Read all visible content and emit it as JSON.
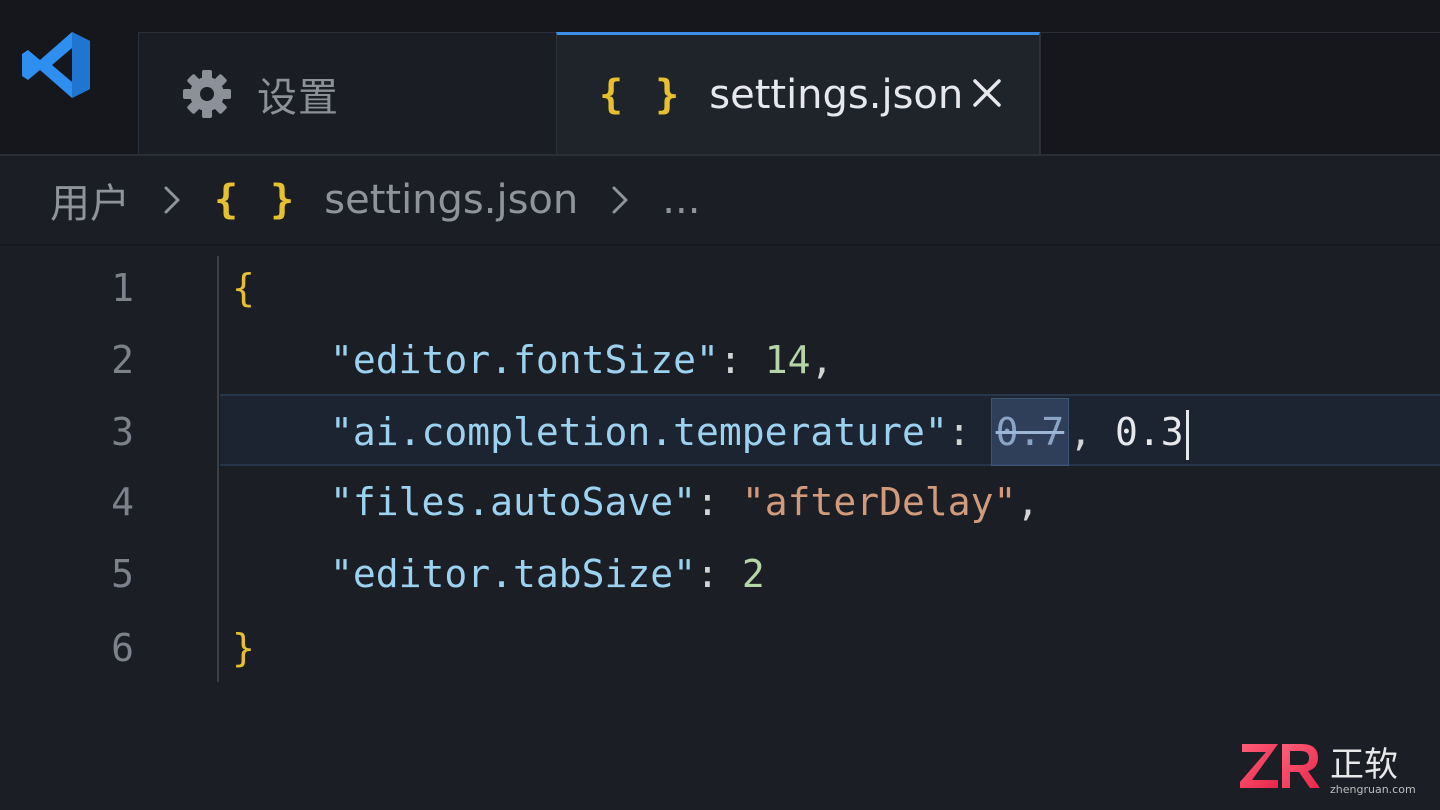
{
  "tabs": [
    {
      "label": "设置",
      "icon": "gear-icon",
      "active": false
    },
    {
      "label": "settings.json",
      "icon": "json-braces-icon",
      "active": true,
      "closable": true
    }
  ],
  "json_icon_glyph": "{ }",
  "close_glyph": "×",
  "breadcrumb": {
    "items": [
      "用户",
      "settings.json"
    ],
    "ellipsis": "..."
  },
  "editor": {
    "lines": [
      {
        "number": "1",
        "brace": "{"
      },
      {
        "number": "2",
        "key": "\"editor.fontSize\"",
        "colon": ": ",
        "value": "14",
        "trail": ","
      },
      {
        "number": "3",
        "key": "\"ai.completion.temperature\"",
        "colon": ":",
        "old_value": "0.7",
        "sep": ", ",
        "new_value": "0.3"
      },
      {
        "number": "4",
        "key": "\"files.autoSave\"",
        "colon": ": ",
        "value": "\"afterDelay\"",
        "trail": ","
      },
      {
        "number": "5",
        "key": "\"editor.tabSize\"",
        "colon": ": ",
        "value": "2"
      },
      {
        "number": "6",
        "brace": "}"
      }
    ]
  },
  "watermark": {
    "text": "正软",
    "site": "zhengruan.com"
  },
  "colors": {
    "accent": "#3b8eea",
    "brace": "#e5c130",
    "key": "#9cd2f0",
    "number": "#b5d5a8",
    "string": "#d19a7a"
  }
}
